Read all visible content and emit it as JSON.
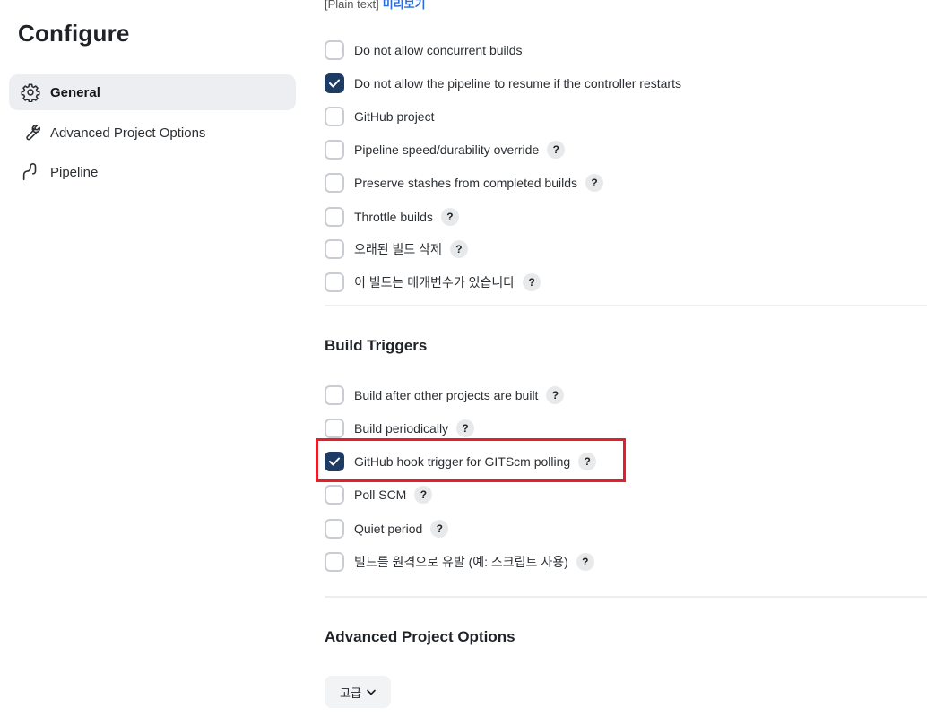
{
  "page": {
    "title": "Configure"
  },
  "sidebar": {
    "items": [
      {
        "label": "General",
        "icon": "gear-icon",
        "active": true
      },
      {
        "label": "Advanced Project Options",
        "icon": "wrench-icon",
        "active": false
      },
      {
        "label": "Pipeline",
        "icon": "pipeline-icon",
        "active": false
      }
    ]
  },
  "description": {
    "plain_text_label": "[Plain text]",
    "preview_link": "미리보기"
  },
  "general_options": [
    {
      "label": "Do not allow concurrent builds",
      "checked": false,
      "help": false
    },
    {
      "label": "Do not allow the pipeline to resume if the controller restarts",
      "checked": true,
      "help": false
    },
    {
      "label": "GitHub project",
      "checked": false,
      "help": false
    },
    {
      "label": "Pipeline speed/durability override",
      "checked": false,
      "help": true
    },
    {
      "label": "Preserve stashes from completed builds",
      "checked": false,
      "help": true
    },
    {
      "label": "Throttle builds",
      "checked": false,
      "help": true
    },
    {
      "label": "오래된 빌드 삭제",
      "checked": false,
      "help": true
    },
    {
      "label": "이 빌드는 매개변수가 있습니다",
      "checked": false,
      "help": true
    }
  ],
  "build_triggers": {
    "title": "Build Triggers",
    "options": [
      {
        "label": "Build after other projects are built",
        "checked": false,
        "help": true
      },
      {
        "label": "Build periodically",
        "checked": false,
        "help": true
      },
      {
        "label": "GitHub hook trigger for GITScm polling",
        "checked": true,
        "help": true,
        "highlighted": true
      },
      {
        "label": "Poll SCM",
        "checked": false,
        "help": true
      },
      {
        "label": "Quiet period",
        "checked": false,
        "help": true
      },
      {
        "label": "빌드를 원격으로 유발 (예: 스크립트 사용)",
        "checked": false,
        "help": true
      }
    ]
  },
  "advanced_project_options": {
    "title": "Advanced Project Options",
    "button_label": "고급"
  },
  "help_glyph": "?",
  "colors": {
    "checked": "#1d3b63",
    "highlight": "#e0202a",
    "link": "#2a6ed6",
    "active_nav_bg": "#eceef2"
  }
}
